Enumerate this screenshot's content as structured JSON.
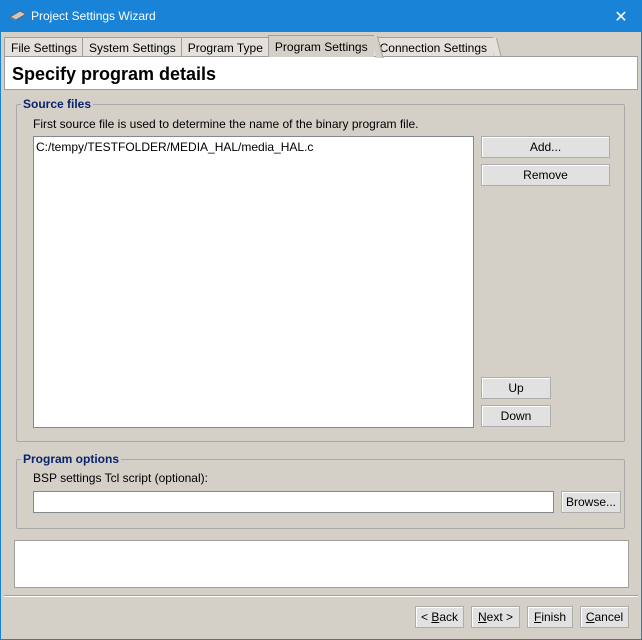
{
  "window": {
    "title": "Project Settings Wizard",
    "close_glyph": "✕"
  },
  "tabs": [
    {
      "label": "File Settings",
      "active": false
    },
    {
      "label": "System Settings",
      "active": false
    },
    {
      "label": "Program Type",
      "active": false
    },
    {
      "label": "Program Settings",
      "active": true
    },
    {
      "label": "Connection Settings",
      "active": false
    }
  ],
  "header": {
    "title": "Specify program details"
  },
  "source_files": {
    "legend": "Source files",
    "description": "First source file is used to determine the name of the binary program file.",
    "items": [
      "C:/tempy/TESTFOLDER/MEDIA_HAL/media_HAL.c"
    ],
    "add_label": "Add...",
    "remove_label": "Remove",
    "up_label": "Up",
    "down_label": "Down"
  },
  "program_options": {
    "legend": "Program options",
    "bsp_label": "BSP settings Tcl script (optional):",
    "bsp_value": "",
    "browse_label": "Browse..."
  },
  "footer": {
    "back_prefix": "< ",
    "back_mnemonic": "B",
    "back_rest": "ack",
    "next_mnemonic": "N",
    "next_rest": "ext >",
    "finish_mnemonic": "F",
    "finish_rest": "inish",
    "cancel_mnemonic": "C",
    "cancel_rest": "ancel"
  },
  "colors": {
    "titlebar": "#1883d7",
    "legend_text": "#0a246a",
    "dialog_bg": "#d4d0c8"
  }
}
